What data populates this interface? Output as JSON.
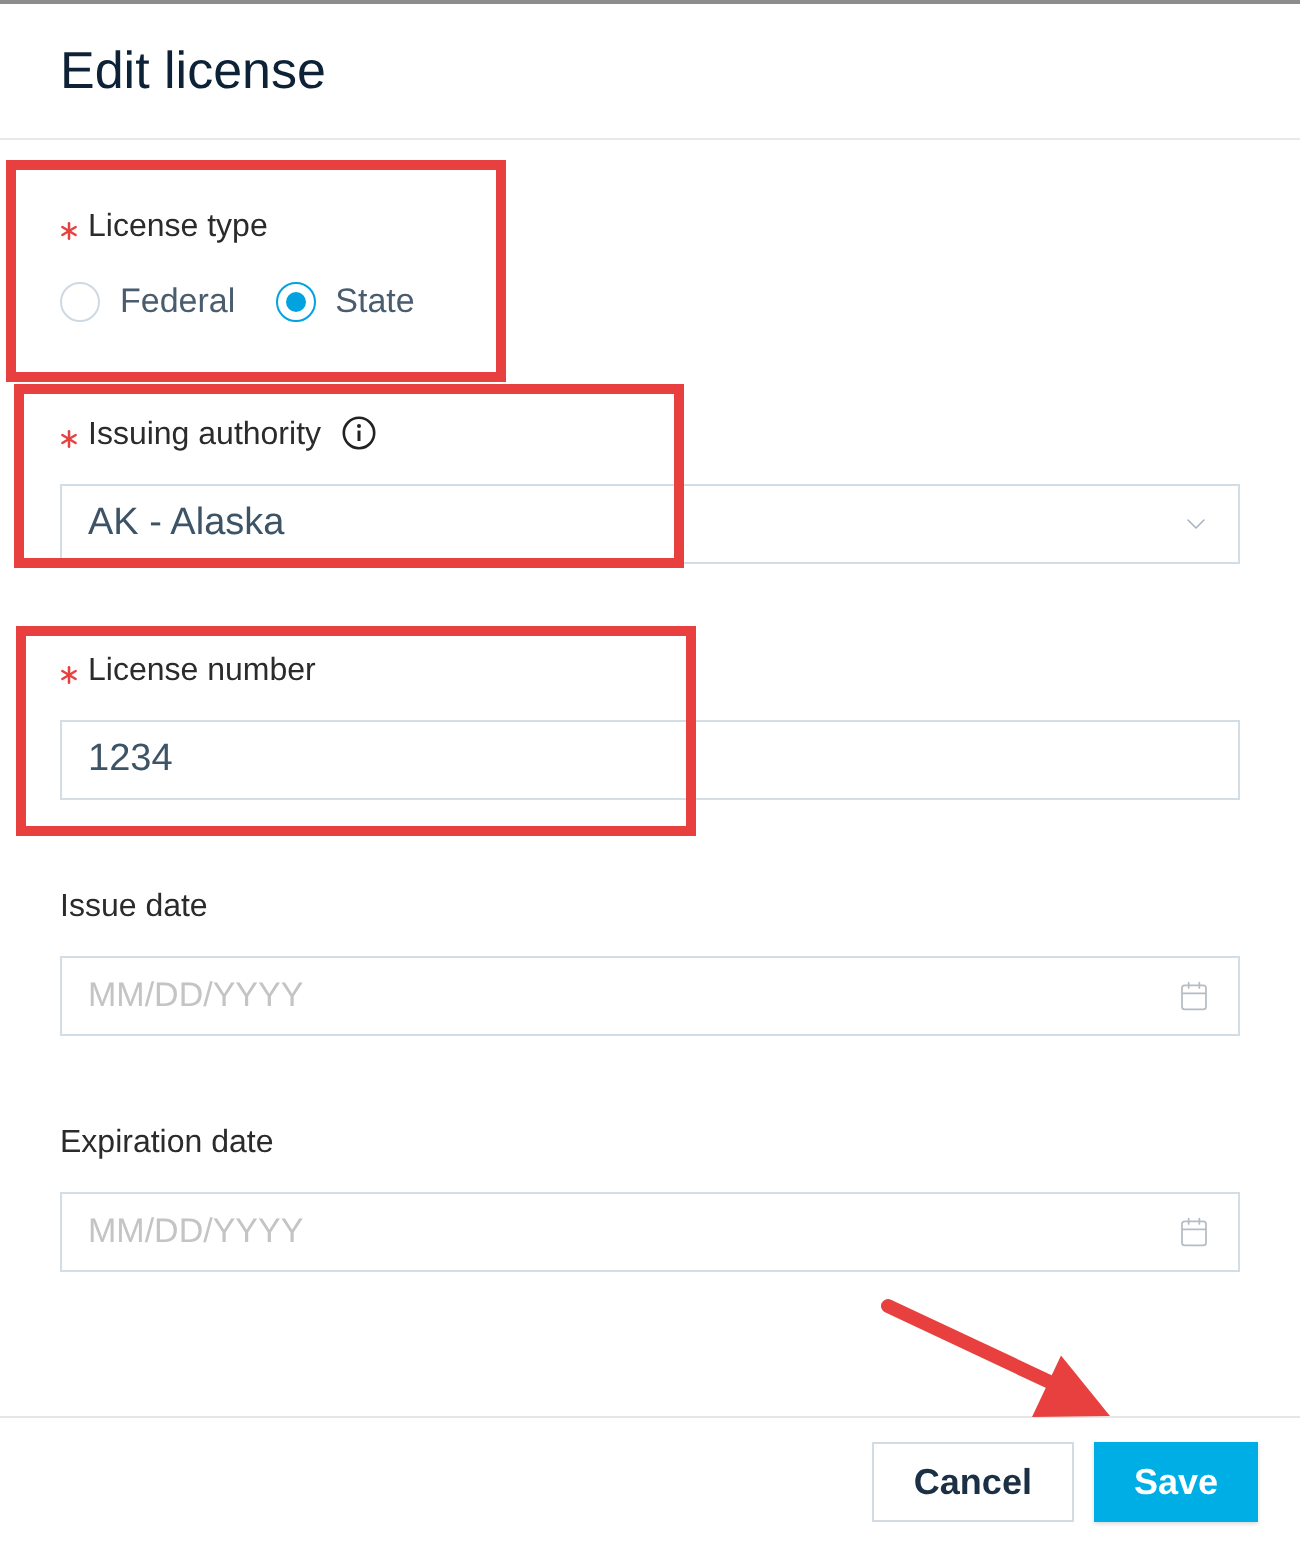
{
  "dialog": {
    "title": "Edit license"
  },
  "fields": [
    {
      "kind": "radio",
      "label": "License type",
      "required": true,
      "highlighted": true,
      "options": [
        {
          "label": "Federal",
          "selected": false
        },
        {
          "label": "State",
          "selected": true
        }
      ]
    },
    {
      "kind": "select",
      "label": "Issuing authority",
      "required": true,
      "info": true,
      "highlighted": true,
      "value": "AK - Alaska"
    },
    {
      "kind": "text",
      "label": "License number",
      "required": true,
      "highlighted": true,
      "value": "1234"
    },
    {
      "kind": "date",
      "label": "Issue date",
      "required": false,
      "highlighted": false,
      "placeholder": "MM/DD/YYYY"
    },
    {
      "kind": "date",
      "label": "Expiration date",
      "required": false,
      "highlighted": false,
      "placeholder": "MM/DD/YYYY"
    }
  ],
  "buttons": [
    {
      "kind": "secondary",
      "label": "Cancel"
    },
    {
      "kind": "primary",
      "label": "Save"
    }
  ],
  "annotations": [
    {
      "kind": "arrow"
    }
  ]
}
